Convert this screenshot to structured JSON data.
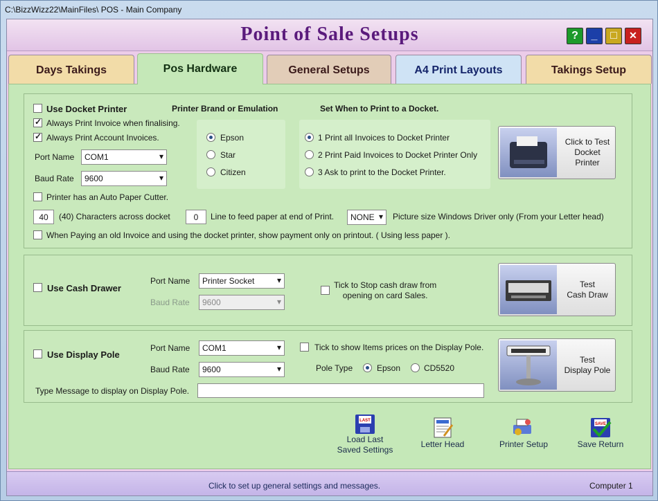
{
  "window": {
    "title": "C:\\BizzWizz22\\MainFiles\\ POS - Main Company"
  },
  "header": {
    "title": "Point of Sale Setups",
    "help": "?",
    "minimize": "_",
    "maximize": "□",
    "close": "✕"
  },
  "tabs": [
    "Days Takings",
    "Pos Hardware",
    "General Setups",
    "A4 Print Layouts",
    "Takings Setup"
  ],
  "docket": {
    "use_label": "Use Docket Printer",
    "brand_header": "Printer Brand or Emulation",
    "when_header": "Set When to Print to a Docket.",
    "always_invoice": "Always Print Invoice when finalising.",
    "always_account": "Always Print Account Invoices.",
    "port_label": "Port Name",
    "port_value": "COM1",
    "baud_label": "Baud Rate",
    "baud_value": "9600",
    "brands": [
      "Epson",
      "Star",
      "Citizen"
    ],
    "when_options": [
      "1 Print all Invoices to Docket Printer",
      "2 Print Paid Invoices to Docket Printer Only",
      "3 Ask to print to the Docket Printer."
    ],
    "test_button": "Click to Test\nDocket\nPrinter",
    "auto_cutter": "Printer has an Auto Paper Cutter.",
    "chars_value": "40",
    "chars_label": "(40) Characters across docket",
    "feed_value": "0",
    "feed_label": "Line to feed paper at end of Print.",
    "picture_value": "NONE",
    "picture_label": "Picture size Windows Driver only (From your Letter head)",
    "old_invoice": "When Paying an old Invoice and using the docket printer,  show payment only on printout.  ( Using less paper )."
  },
  "cash": {
    "use_label": "Use Cash Drawer",
    "port_label": "Port Name",
    "port_value": "Printer Socket",
    "baud_label": "Baud Rate",
    "baud_value": "9600",
    "stop_label": "Tick to Stop cash draw from\nopening on card Sales.",
    "test_button": "Test\nCash Draw"
  },
  "pole": {
    "use_label": "Use Display Pole",
    "port_label": "Port Name",
    "port_value": "COM1",
    "baud_label": "Baud Rate",
    "baud_value": "9600",
    "show_prices": "Tick to show Items prices on the Display Pole.",
    "pole_type_label": "Pole Type",
    "types": [
      "Epson",
      "CD5520"
    ],
    "message_label": "Type Message to display on Display Pole.",
    "message_value": "",
    "test_button": "Test\nDisplay Pole"
  },
  "toolbar": {
    "load_last": "Load Last\nSaved Settings",
    "letter_head": "Letter Head",
    "printer_setup": "Printer Setup",
    "save_return": "Save Return"
  },
  "status": {
    "message": "Click to set up general settings and messages.",
    "computer": "Computer 1"
  }
}
